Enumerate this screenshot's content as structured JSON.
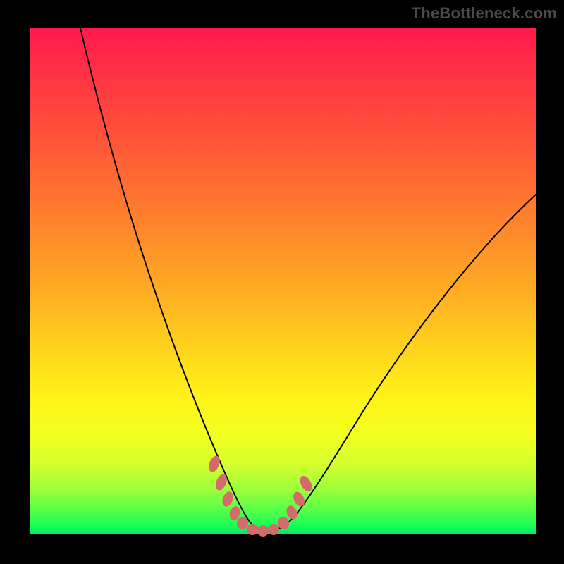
{
  "watermark": "TheBottleneck.com",
  "chart_data": {
    "type": "line",
    "title": "",
    "xlabel": "",
    "ylabel": "",
    "xlim": [
      0,
      100
    ],
    "ylim": [
      0,
      100
    ],
    "grid": false,
    "legend": false,
    "background_gradient": {
      "top": "#ff1a4d",
      "mid": "#fff318",
      "bottom": "#00e86a"
    },
    "series": [
      {
        "name": "bottleneck-curve",
        "x": [
          10,
          14,
          18,
          22,
          26,
          30,
          33,
          36,
          38,
          40,
          42,
          44,
          47,
          50,
          55,
          60,
          66,
          74,
          82,
          90,
          100
        ],
        "y": [
          100,
          83,
          69,
          56,
          44,
          33,
          24,
          16,
          10,
          5,
          2,
          1,
          1,
          2,
          6,
          12,
          20,
          31,
          42,
          52,
          63
        ]
      }
    ],
    "markers": {
      "name": "highlighted-range",
      "color": "#d46a6a",
      "points": [
        {
          "x": 36.5,
          "y": 14
        },
        {
          "x": 37.8,
          "y": 10
        },
        {
          "x": 39.0,
          "y": 6.5
        },
        {
          "x": 40.5,
          "y": 3.5
        },
        {
          "x": 42.0,
          "y": 1.8
        },
        {
          "x": 44.0,
          "y": 1.0
        },
        {
          "x": 46.0,
          "y": 1.0
        },
        {
          "x": 48.0,
          "y": 1.6
        },
        {
          "x": 50.0,
          "y": 3.0
        },
        {
          "x": 51.5,
          "y": 5.2
        },
        {
          "x": 52.8,
          "y": 7.6
        },
        {
          "x": 54.0,
          "y": 10.5
        }
      ]
    }
  }
}
